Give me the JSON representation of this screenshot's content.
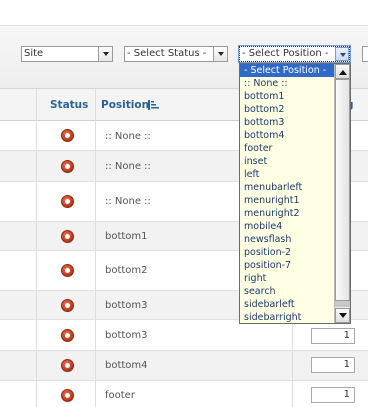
{
  "filters": {
    "site": "Site",
    "status": "- Select Status -",
    "position": "- Select Position -"
  },
  "table": {
    "headers": {
      "status": "Status",
      "position": "Position",
      "order_partial": "g"
    },
    "rows": [
      {
        "position": ":: None ::",
        "order": ""
      },
      {
        "position": ":: None ::",
        "order": ""
      },
      {
        "position": ":: None ::",
        "order": ""
      },
      {
        "position": "bottom1",
        "order": ""
      },
      {
        "position": "bottom2",
        "order": ""
      },
      {
        "position": "bottom3",
        "order": ""
      },
      {
        "position": "bottom3",
        "order": "1"
      },
      {
        "position": "bottom4",
        "order": "1"
      },
      {
        "position": "footer",
        "order": "1"
      }
    ]
  },
  "dropdown": {
    "items": [
      "- Select Position -",
      ":: None ::",
      "bottom1",
      "bottom2",
      "bottom3",
      "bottom4",
      "footer",
      "inset",
      "left",
      "menubarleft",
      "menuright1",
      "menuright2",
      "mobile4",
      "newsflash",
      "position-2",
      "position-7",
      "right",
      "search",
      "sidebarleft",
      "sidebarright"
    ]
  },
  "colors": {
    "header_link": "#2a6496",
    "status_dot": "#c4451f",
    "dropdown_bg": "#ffffe3",
    "selected_bg": "#3169c6"
  }
}
